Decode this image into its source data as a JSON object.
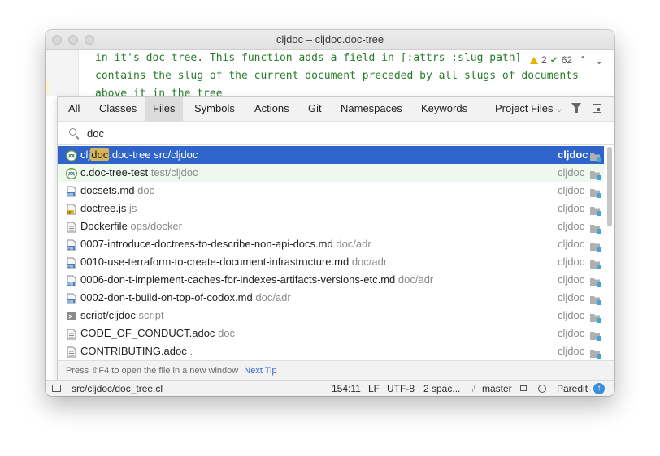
{
  "window": {
    "title": "cljdoc – cljdoc.doc-tree"
  },
  "editor": {
    "lines": [
      "in it's doc tree. This function adds a field in [:attrs :slug-path]",
      "contains the slug of the current document preceded by all slugs of documents",
      "above it in the tree"
    ],
    "warnings": "2",
    "checks": "62"
  },
  "tabs": [
    {
      "label": "All"
    },
    {
      "label": "Classes"
    },
    {
      "label": "Files",
      "active": true
    },
    {
      "label": "Symbols"
    },
    {
      "label": "Actions"
    },
    {
      "label": "Git"
    },
    {
      "label": "Namespaces"
    },
    {
      "label": "Keywords"
    }
  ],
  "scope": {
    "label": "Project Files"
  },
  "search": {
    "value": "doc"
  },
  "results": [
    {
      "icon": "clojure-namespace-icon",
      "pre": "clj",
      "match": "doc",
      "post": ".doc-tree",
      "path": "src/cljdoc",
      "project": "cljdoc",
      "selected": true
    },
    {
      "icon": "clojure-namespace-icon",
      "pre": "c.doc-tree-test",
      "match": "",
      "post": "",
      "path": "test/cljdoc",
      "project": "cljdoc",
      "tinted": true
    },
    {
      "icon": "markdown-file-icon",
      "pre": "docsets.md",
      "match": "",
      "post": "",
      "path": "doc",
      "project": "cljdoc"
    },
    {
      "icon": "js-file-icon",
      "pre": "doctree.js",
      "match": "",
      "post": "",
      "path": "js",
      "project": "cljdoc"
    },
    {
      "icon": "text-file-icon",
      "pre": "Dockerfile",
      "match": "",
      "post": "",
      "path": "ops/docker",
      "project": "cljdoc"
    },
    {
      "icon": "markdown-file-icon",
      "pre": "0007-introduce-doctrees-to-describe-non-api-docs.md",
      "match": "",
      "post": "",
      "path": "doc/adr",
      "project": "cljdoc"
    },
    {
      "icon": "markdown-file-icon",
      "pre": "0010-use-terraform-to-create-document-infrastructure.md",
      "match": "",
      "post": "",
      "path": "doc/adr",
      "project": "cljdoc"
    },
    {
      "icon": "markdown-file-icon",
      "pre": "0006-don-t-implement-caches-for-indexes-artifacts-versions-etc.md",
      "match": "",
      "post": "",
      "path": "doc/adr",
      "project": "cljdoc"
    },
    {
      "icon": "markdown-file-icon",
      "pre": "0002-don-t-build-on-top-of-codox.md",
      "match": "",
      "post": "",
      "path": "doc/adr",
      "project": "cljdoc"
    },
    {
      "icon": "script-file-icon",
      "pre": "script/cljdoc",
      "match": "",
      "post": "",
      "path": "script",
      "project": "cljdoc"
    },
    {
      "icon": "text-file-icon",
      "pre": "CODE_OF_CONDUCT.adoc",
      "match": "",
      "post": "",
      "path": "doc",
      "project": "cljdoc"
    },
    {
      "icon": "text-file-icon",
      "pre": "CONTRIBUTING.adoc",
      "match": "",
      "post": "",
      "path": ".",
      "project": "cljdoc"
    }
  ],
  "footer": {
    "tip": "Press ⇧F4 to open the file in a new window",
    "next_tip": "Next Tip"
  },
  "statusbar": {
    "file": "src/cljdoc/doc_tree.cl",
    "position": "154:11",
    "line_sep": "LF",
    "encoding": "UTF-8",
    "indent": "2 spac...",
    "branch": "master",
    "paredit": "Paredit"
  },
  "colors": {
    "accent": "#2f65ca",
    "code": "#287c2b",
    "highlight": "#d6b656"
  }
}
